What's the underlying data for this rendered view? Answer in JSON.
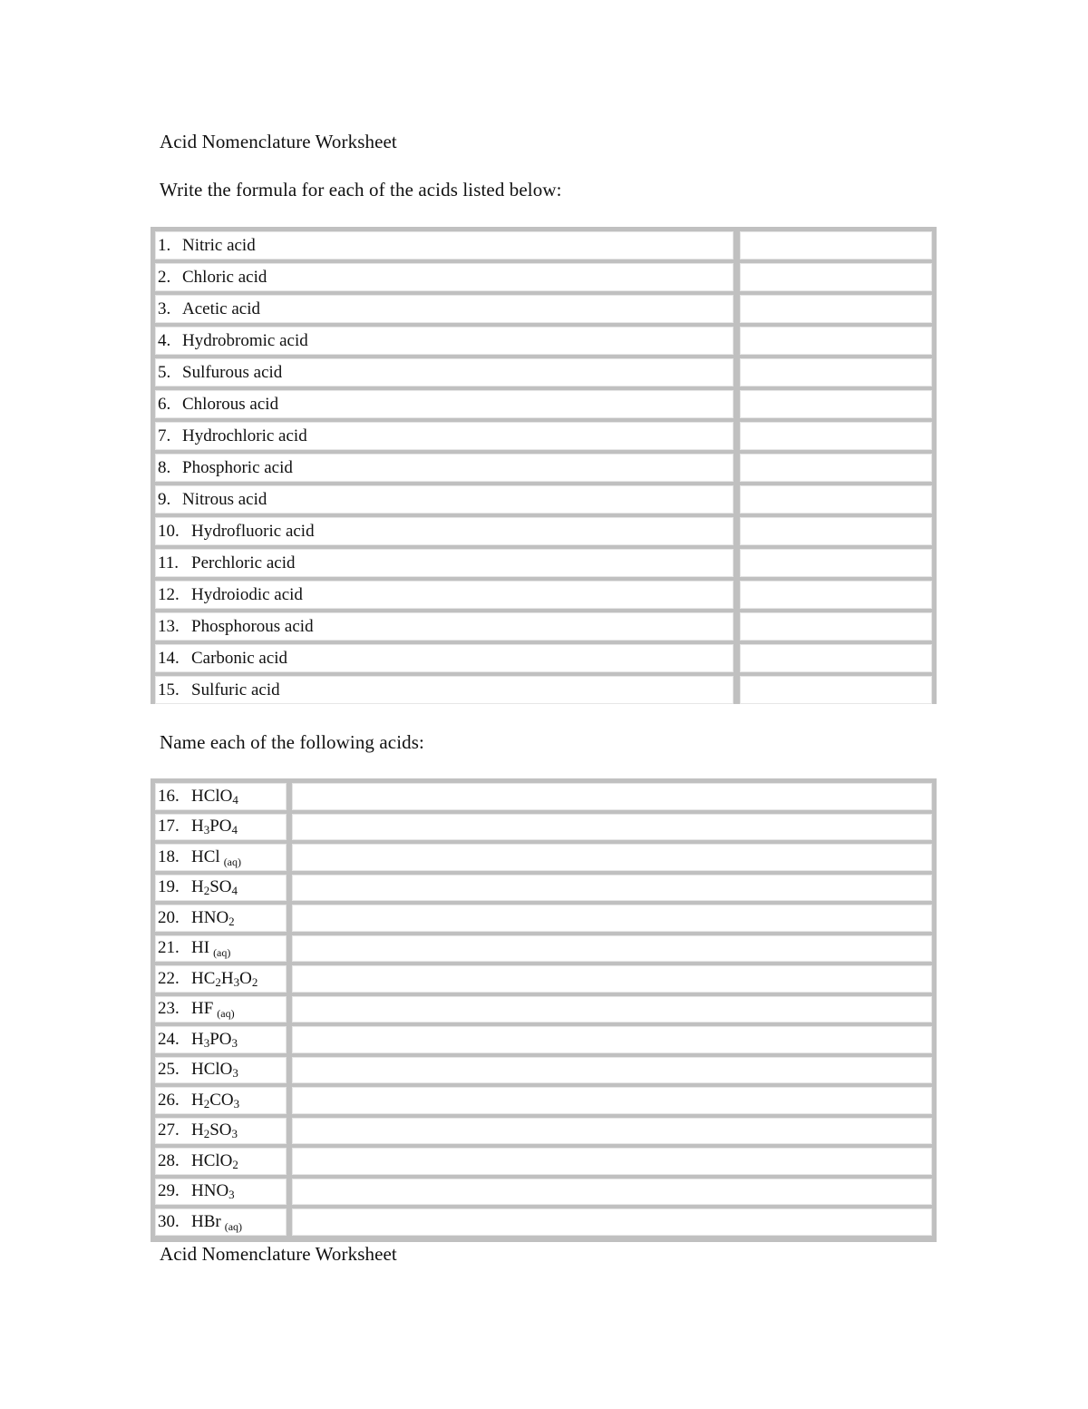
{
  "document": {
    "title": "Acid Nomenclature Worksheet",
    "section1_instruction": "Write the formula for each of the acids listed below:",
    "section2_instruction": "Name each of the following acids:",
    "footer_title": "Acid Nomenclature Worksheet"
  },
  "table1": {
    "rows": [
      {
        "num": "1.",
        "name": "Nitric acid",
        "answer": ""
      },
      {
        "num": "2.",
        "name": "Chloric acid",
        "answer": ""
      },
      {
        "num": "3.",
        "name": "Acetic acid",
        "answer": ""
      },
      {
        "num": "4.",
        "name": "Hydrobromic acid",
        "answer": ""
      },
      {
        "num": "5.",
        "name": "Sulfurous acid",
        "answer": ""
      },
      {
        "num": "6.",
        "name": "Chlorous acid",
        "answer": ""
      },
      {
        "num": "7.",
        "name": "Hydrochloric acid",
        "answer": ""
      },
      {
        "num": "8.",
        "name": "Phosphoric acid",
        "answer": ""
      },
      {
        "num": "9.",
        "name": "Nitrous acid",
        "answer": ""
      },
      {
        "num": "10.",
        "name": "Hydrofluoric acid",
        "answer": ""
      },
      {
        "num": "11.",
        "name": "Perchloric acid",
        "answer": ""
      },
      {
        "num": "12.",
        "name": "Hydroiodic acid",
        "answer": ""
      },
      {
        "num": "13.",
        "name": "Phosphorous acid",
        "answer": ""
      },
      {
        "num": "14.",
        "name": "Carbonic acid",
        "answer": ""
      },
      {
        "num": "15.",
        "name": "Sulfuric acid",
        "answer": ""
      }
    ]
  },
  "table2": {
    "rows": [
      {
        "num": "16.",
        "formula": [
          [
            "HClO",
            ""
          ],
          [
            "4",
            "sub"
          ]
        ],
        "answer": ""
      },
      {
        "num": "17.",
        "formula": [
          [
            "H",
            ""
          ],
          [
            "3",
            "sub"
          ],
          [
            "PO",
            ""
          ],
          [
            "4",
            "sub"
          ]
        ],
        "answer": ""
      },
      {
        "num": "18.",
        "formula": [
          [
            "HCl",
            ""
          ],
          [
            "(aq)",
            "aq"
          ]
        ],
        "answer": ""
      },
      {
        "num": "19.",
        "formula": [
          [
            "H",
            ""
          ],
          [
            "2",
            "sub"
          ],
          [
            "SO",
            ""
          ],
          [
            "4",
            "sub"
          ]
        ],
        "answer": ""
      },
      {
        "num": "20.",
        "formula": [
          [
            "HNO",
            ""
          ],
          [
            "2",
            "sub"
          ]
        ],
        "answer": ""
      },
      {
        "num": "21.",
        "formula": [
          [
            "HI",
            ""
          ],
          [
            "(aq)",
            "aq"
          ]
        ],
        "answer": ""
      },
      {
        "num": "22.",
        "formula": [
          [
            "HC",
            ""
          ],
          [
            "2",
            "sub"
          ],
          [
            "H",
            ""
          ],
          [
            "3",
            "sub"
          ],
          [
            "O",
            ""
          ],
          [
            "2",
            "sub"
          ]
        ],
        "answer": ""
      },
      {
        "num": "23.",
        "formula": [
          [
            "HF",
            ""
          ],
          [
            "(aq)",
            "aq"
          ]
        ],
        "answer": ""
      },
      {
        "num": "24.",
        "formula": [
          [
            "H",
            ""
          ],
          [
            "3",
            "sub"
          ],
          [
            "PO",
            ""
          ],
          [
            "3",
            "sub"
          ]
        ],
        "answer": ""
      },
      {
        "num": "25.",
        "formula": [
          [
            "HClO",
            ""
          ],
          [
            "3",
            "sub"
          ]
        ],
        "answer": ""
      },
      {
        "num": "26.",
        "formula": [
          [
            "H",
            ""
          ],
          [
            "2",
            "sub"
          ],
          [
            "CO",
            ""
          ],
          [
            "3",
            "sub"
          ]
        ],
        "answer": ""
      },
      {
        "num": "27.",
        "formula": [
          [
            "H",
            ""
          ],
          [
            "2",
            "sub"
          ],
          [
            "SO",
            ""
          ],
          [
            "3",
            "sub"
          ]
        ],
        "answer": ""
      },
      {
        "num": "28.",
        "formula": [
          [
            "HClO",
            ""
          ],
          [
            "2",
            "sub"
          ]
        ],
        "answer": ""
      },
      {
        "num": "29.",
        "formula": [
          [
            "HNO",
            ""
          ],
          [
            "3",
            "sub"
          ]
        ],
        "answer": ""
      },
      {
        "num": "30.",
        "formula": [
          [
            "HBr",
            ""
          ],
          [
            "(aq)",
            "aq"
          ]
        ],
        "answer": ""
      }
    ]
  }
}
